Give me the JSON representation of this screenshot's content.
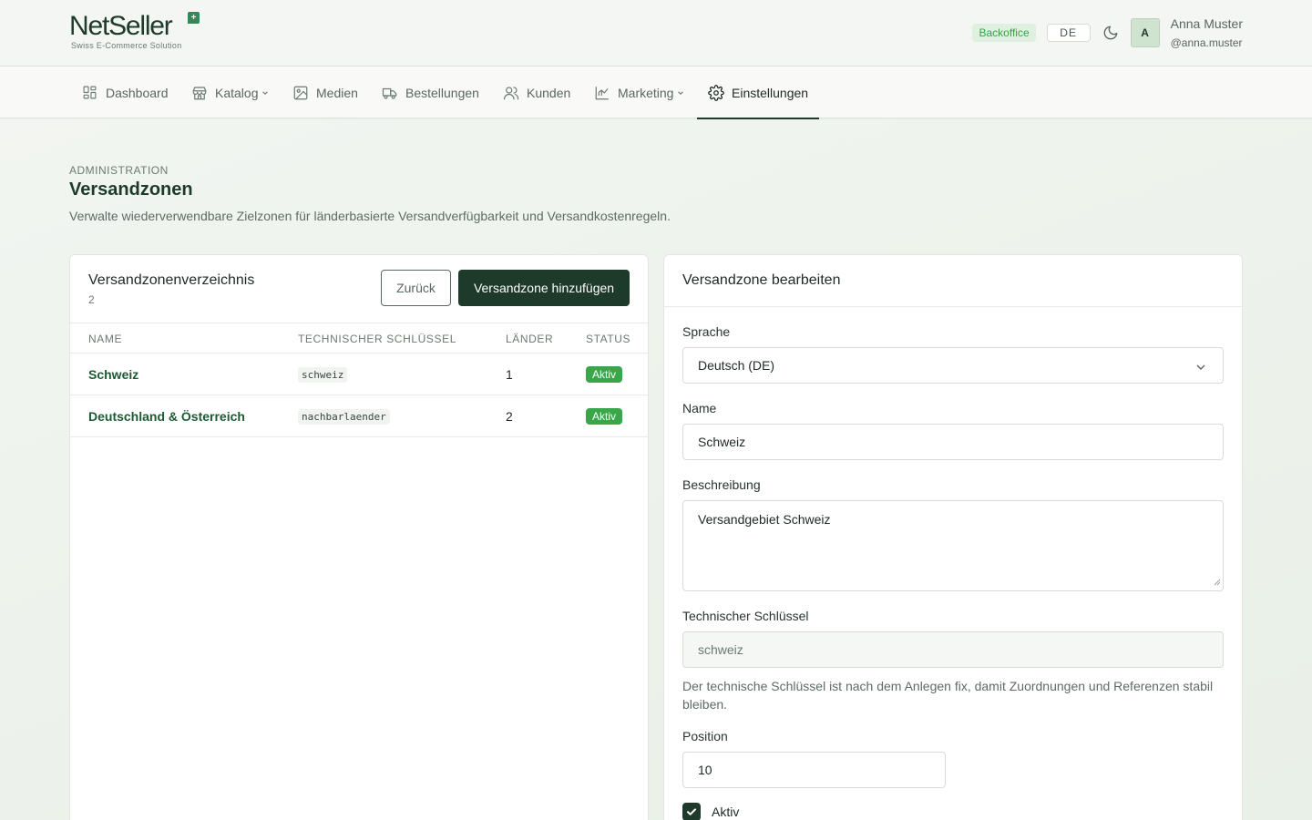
{
  "header": {
    "logo_text": "NetSeller",
    "logo_badge": "+",
    "logo_tagline": "Swiss E-Commerce Solution",
    "env_badge": "Backoffice",
    "language": "DE",
    "avatar_initial": "A",
    "user_name": "Anna Muster",
    "user_handle": "@anna.muster"
  },
  "nav": {
    "items": [
      {
        "label": "Dashboard",
        "icon": "dashboard-icon"
      },
      {
        "label": "Katalog",
        "icon": "store-icon",
        "has_dropdown": true
      },
      {
        "label": "Medien",
        "icon": "image-icon"
      },
      {
        "label": "Bestellungen",
        "icon": "truck-icon"
      },
      {
        "label": "Kunden",
        "icon": "users-icon"
      },
      {
        "label": "Marketing",
        "icon": "chart-icon",
        "has_dropdown": true
      },
      {
        "label": "Einstellungen",
        "icon": "gear-icon",
        "active": true
      }
    ]
  },
  "page": {
    "eyebrow": "ADMINISTRATION",
    "title": "Versandzonen",
    "description": "Verwalte wiederverwendbare Zielzonen für länderbasierte Versandverfügbarkeit und Versandkostenregeln."
  },
  "directory": {
    "title": "Versandzonenverzeichnis",
    "count": "2",
    "back_label": "Zurück",
    "add_label": "Versandzone hinzufügen",
    "columns": [
      "NAME",
      "TECHNISCHER SCHLÜSSEL",
      "LÄNDER",
      "STATUS"
    ],
    "rows": [
      {
        "name": "Schweiz",
        "key": "schweiz",
        "countries": "1",
        "status": "Aktiv"
      },
      {
        "name": "Deutschland & Österreich",
        "key": "nachbarlaender",
        "countries": "2",
        "status": "Aktiv"
      }
    ]
  },
  "editor": {
    "title": "Versandzone bearbeiten",
    "language_label": "Sprache",
    "language_value": "Deutsch (DE)",
    "name_label": "Name",
    "name_value": "Schweiz",
    "description_label": "Beschreibung",
    "description_value": "Versandgebiet Schweiz",
    "key_label": "Technischer Schlüssel",
    "key_value": "schweiz",
    "key_help": "Der technische Schlüssel ist nach dem Anlegen fix, damit Zuordnungen und Referenzen stabil bleiben.",
    "position_label": "Position",
    "position_value": "10",
    "active_label": "Aktiv",
    "active_checked": true
  },
  "colors": {
    "brand": "#1d3a2a",
    "accent_green": "#3aa64a",
    "link_green": "#1d5a34"
  }
}
